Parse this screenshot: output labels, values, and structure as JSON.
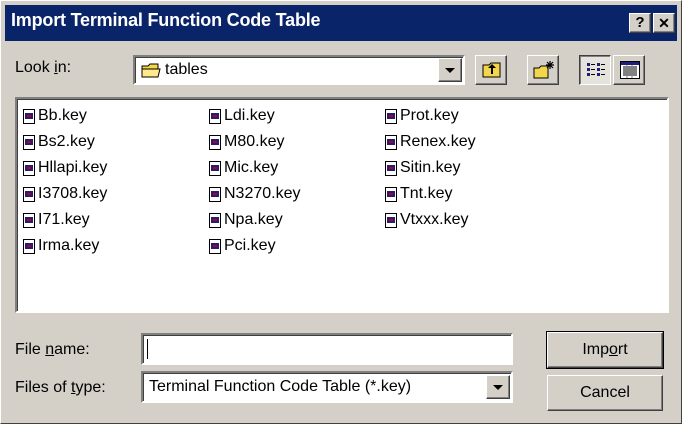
{
  "window": {
    "title": "Import Terminal Function Code Table",
    "help_label": "?",
    "close_label": "✕"
  },
  "look_in": {
    "label_pre": "Look ",
    "label_accel": "i",
    "label_post": "n:",
    "value": "tables",
    "icon": "folder-icon"
  },
  "toolbar": {
    "up_icon": "up-one-level-icon",
    "new_folder_icon": "new-folder-icon",
    "list_view_icon": "list-view-icon",
    "details_view_icon": "details-view-icon"
  },
  "files": {
    "col1": [
      "Bb.key",
      "Bs2.key",
      "Hllapi.key",
      "I3708.key",
      "I71.key",
      "Irma.key"
    ],
    "col2": [
      "Ldi.key",
      "M80.key",
      "Mic.key",
      "N3270.key",
      "Npa.key",
      "Pci.key"
    ],
    "col3": [
      "Prot.key",
      "Renex.key",
      "Sitin.key",
      "Tnt.key",
      "Vtxxx.key"
    ]
  },
  "file_name": {
    "label_pre": "File ",
    "label_accel": "n",
    "label_post": "ame:",
    "value": ""
  },
  "file_type": {
    "label_pre": "Files of ",
    "label_accel": "t",
    "label_post": "ype:",
    "value": "Terminal Function Code Table (*.key)"
  },
  "buttons": {
    "import_pre": "Imp",
    "import_accel": "o",
    "import_post": "rt",
    "cancel": "Cancel"
  },
  "colors": {
    "titlebar": "#0a246a",
    "face": "#d4d0c8",
    "folder": "#f2d64b"
  }
}
